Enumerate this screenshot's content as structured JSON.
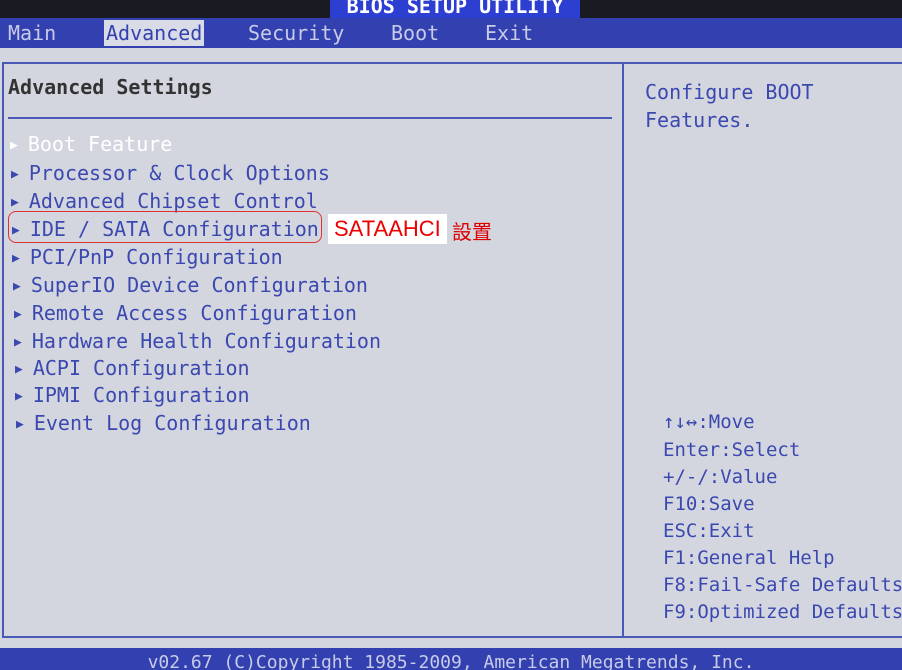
{
  "title": "BIOS SETUP UTILITY",
  "menu": [
    {
      "label": "Main"
    },
    {
      "label": "Advanced",
      "active": true
    },
    {
      "label": "Security"
    },
    {
      "label": "Boot"
    },
    {
      "label": "Exit"
    }
  ],
  "heading": "Advanced Settings",
  "items": [
    {
      "label": "Boot Feature"
    },
    {
      "label": "Processor & Clock Options"
    },
    {
      "label": "Advanced Chipset Control"
    },
    {
      "label": "IDE / SATA Configuration"
    },
    {
      "label": "PCI/PnP Configuration"
    },
    {
      "label": "SuperIO Device Configuration"
    },
    {
      "label": "Remote Access Configuration"
    },
    {
      "label": "Hardware Health Configuration"
    },
    {
      "label": "ACPI Configuration"
    },
    {
      "label": "IPMI Configuration"
    },
    {
      "label": "Event Log Configuration"
    }
  ],
  "annotation": {
    "text": "SATAAHCI",
    "chinese": "設置"
  },
  "help": [
    "Configure BOOT",
    "Features."
  ],
  "keys": [
    "↑↓↔:Move",
    "Enter:Select",
    "+/-/:Value",
    "F10:Save",
    "ESC:Exit",
    "F1:General Help",
    "F8:Fail-Safe Defaults",
    "F9:Optimized Defaults"
  ],
  "footer": "v02.67 (C)Copyright 1985-2009, American Megatrends, Inc.",
  "colors": {
    "accent": "#3340b0",
    "text": "#3a48b0",
    "background": "#d4d6df",
    "annotation": "#e00000"
  }
}
